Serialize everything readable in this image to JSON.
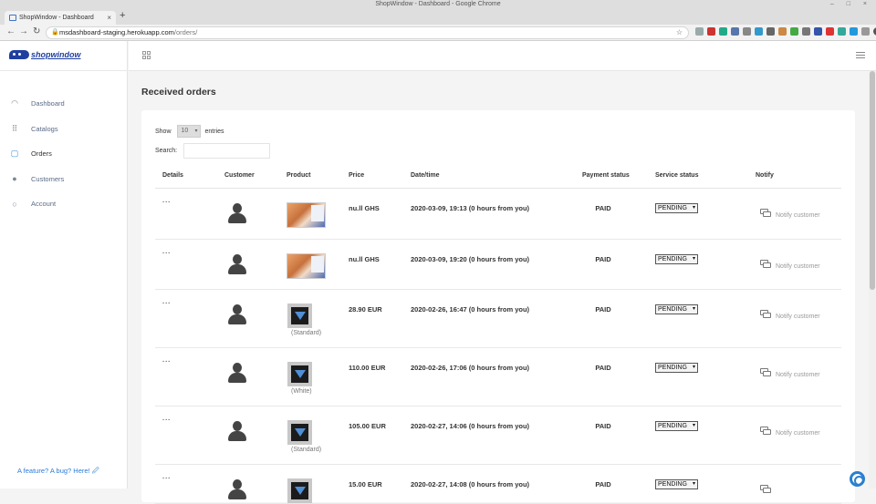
{
  "browser": {
    "window_title": "ShopWindow - Dashboard - Google Chrome",
    "tab_title": "ShopWindow - Dashboard",
    "new_tab": "+",
    "url_host": "msdashboard-staging.herokuapp.com",
    "url_path": "/orders/"
  },
  "brand": {
    "name": "shopwindow",
    "color": "#1f3fa0"
  },
  "sidebar": {
    "items": [
      {
        "label": "Dashboard",
        "icon": "dashboard-icon"
      },
      {
        "label": "Catalogs",
        "icon": "sitemap-icon"
      },
      {
        "label": "Orders",
        "icon": "box-icon"
      },
      {
        "label": "Customers",
        "icon": "user-icon"
      },
      {
        "label": "Account",
        "icon": "account-icon"
      }
    ],
    "active": "Orders",
    "feedback": "A feature? A bug? Here! 🖉"
  },
  "page": {
    "title": "Received orders"
  },
  "table_controls": {
    "show_label": "Show",
    "page_size": "10",
    "entries_label": "entries",
    "search_label": "Search:"
  },
  "columns": [
    "Details",
    "Customer",
    "Product",
    "Price",
    "Date/time",
    "Payment status",
    "Service status",
    "Notify"
  ],
  "orders": [
    {
      "details": "...",
      "product_variant": "",
      "price": "nu.ll GHS",
      "datetime": "2020-03-09, 19:13 (0 hours from you)",
      "payment": "PAID",
      "service": "PENDING",
      "notify": "Notify customer"
    },
    {
      "details": "...",
      "product_variant": "",
      "price": "nu.ll GHS",
      "datetime": "2020-03-09, 19:20 (0 hours from you)",
      "payment": "PAID",
      "service": "PENDING",
      "notify": "Notify customer"
    },
    {
      "details": "...",
      "product_variant": "(Standard)",
      "price": "28.90 EUR",
      "datetime": "2020-02-26, 16:47 (0 hours from you)",
      "payment": "PAID",
      "service": "PENDING",
      "notify": "Notify customer"
    },
    {
      "details": "...",
      "product_variant": "(White)",
      "price": "110.00 EUR",
      "datetime": "2020-02-26, 17:06 (0 hours from you)",
      "payment": "PAID",
      "service": "PENDING",
      "notify": "Notify customer"
    },
    {
      "details": "...",
      "product_variant": "(Standard)",
      "price": "105.00 EUR",
      "datetime": "2020-02-27, 14:06 (0 hours from you)",
      "payment": "PAID",
      "service": "PENDING",
      "notify": "Notify customer"
    },
    {
      "details": "...",
      "product_variant": "",
      "price": "15.00 EUR",
      "datetime": "2020-02-27, 14:08 (0 hours from you)",
      "payment": "PAID",
      "service": "PENDING",
      "notify": ""
    }
  ],
  "colors": {
    "accent": "#2b7bd6",
    "nav_text": "#5a6a85"
  }
}
